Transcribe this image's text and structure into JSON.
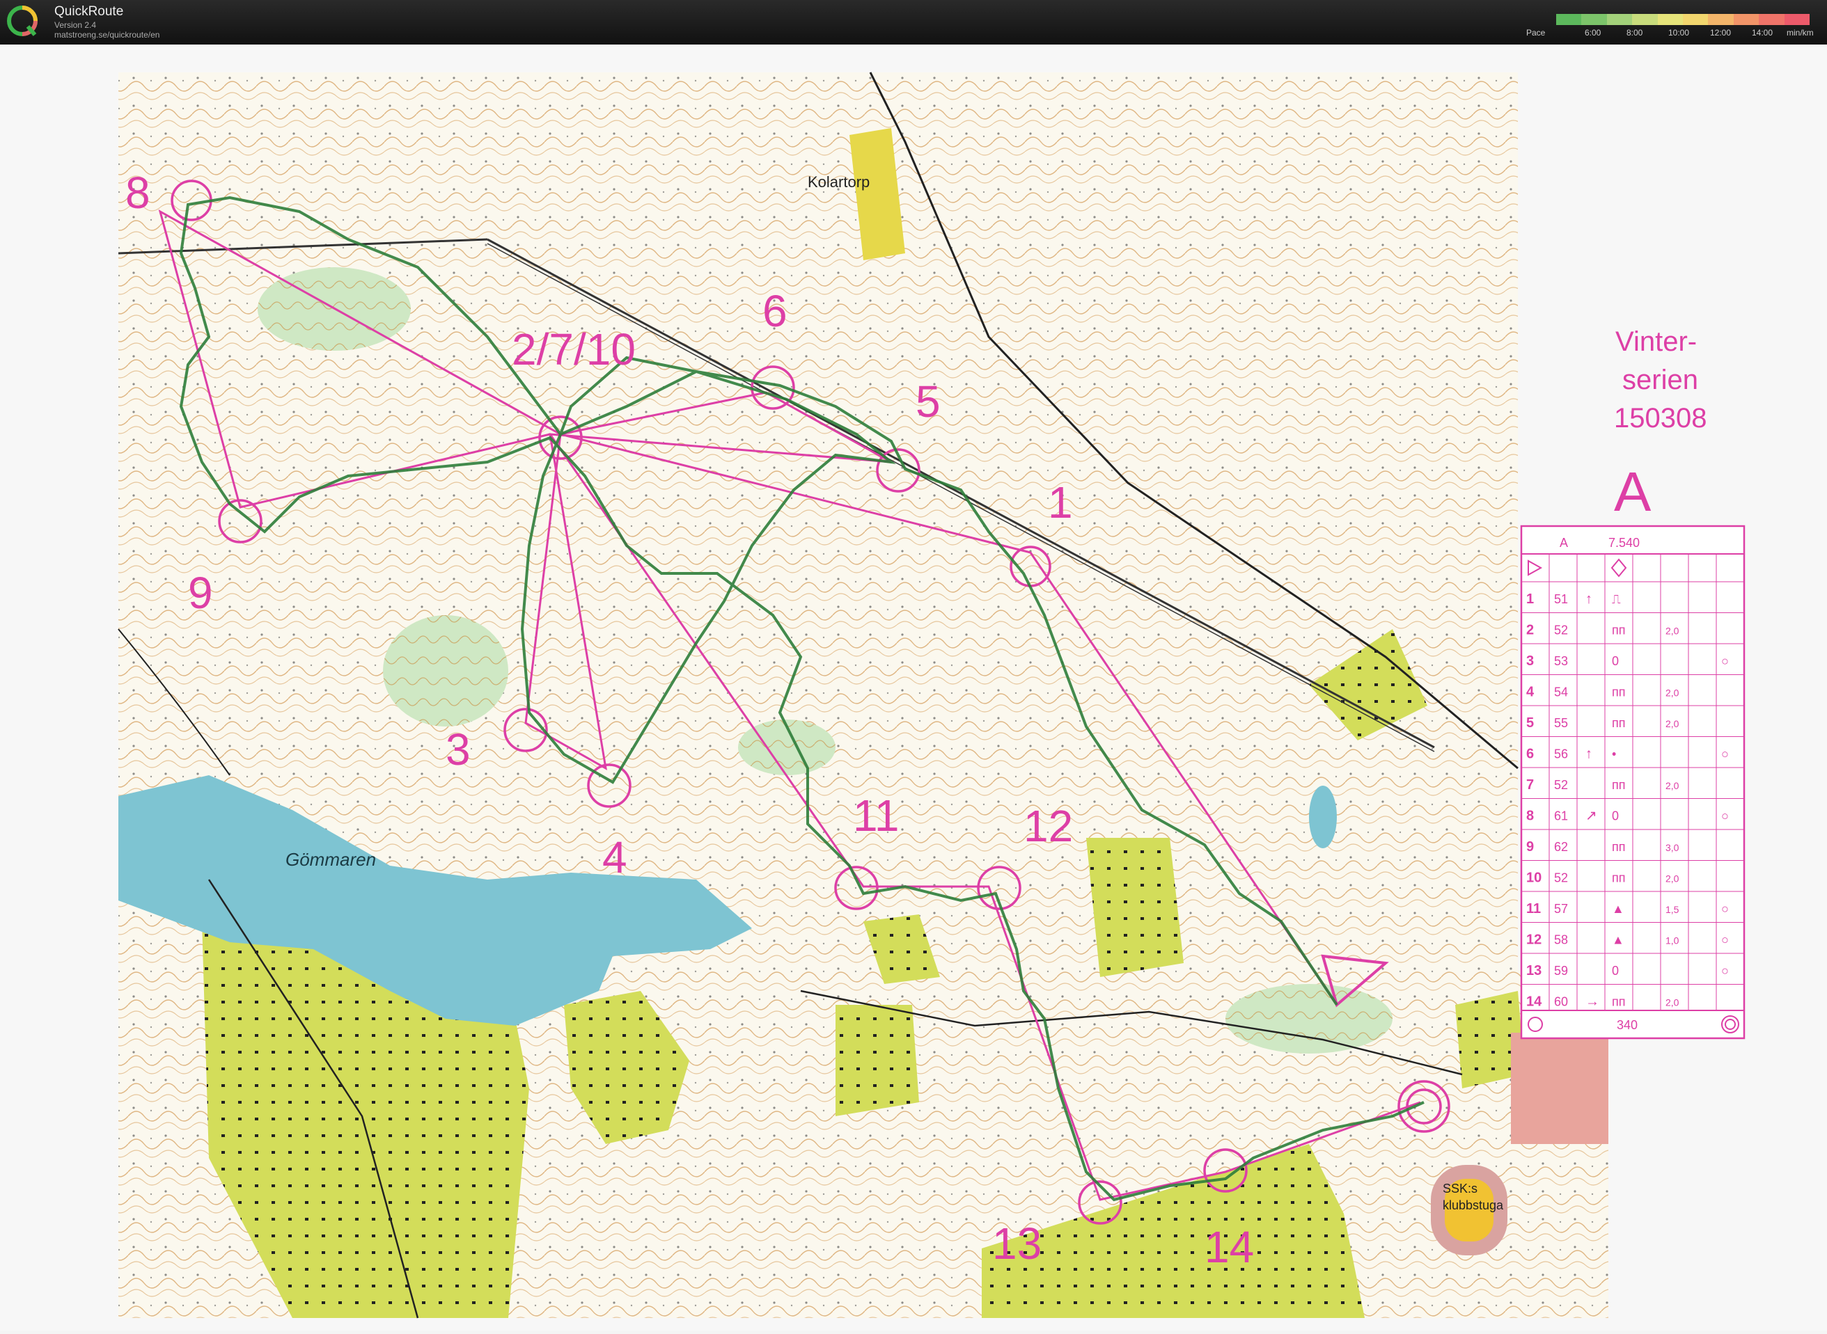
{
  "app": {
    "title": "QuickRoute",
    "version": "Version 2.4",
    "url": "matstroeng.se/quickroute/en"
  },
  "pace_legend": {
    "label": "Pace",
    "ticks": [
      "6:00",
      "8:00",
      "10:00",
      "12:00",
      "14:00"
    ],
    "unit": "min/km",
    "colors": [
      "#5cb85c",
      "#7cc46a",
      "#a3d17a",
      "#c8dc7c",
      "#e6e47a",
      "#f2d66e",
      "#f3b56a",
      "#f19468",
      "#ef7469",
      "#ec5a6a"
    ]
  },
  "map": {
    "event_title_line1": "Vinter-",
    "event_title_line2": "serien",
    "event_date": "150308",
    "course": "A",
    "place_labels": [
      "Kolartorp",
      "Gömmaren",
      "SSK:s",
      "klubbstuga"
    ],
    "control_numbers": [
      "2/7/10",
      "6",
      "5",
      "1",
      "8",
      "9",
      "3",
      "4",
      "11",
      "12",
      "13",
      "14"
    ],
    "colors": {
      "paper": "#fbf8ee",
      "forest_contour": "#c9893a",
      "water": "#7ec4d2",
      "field": "#c8d64a",
      "overprint": "#dd3fa6",
      "route": "#2e7d3a"
    }
  },
  "control_card": {
    "course": "A",
    "length": "7.540",
    "rows": [
      {
        "n": "1",
        "code": "51",
        "dir": "↑",
        "feature": "⎍",
        "size": "",
        "extra": ""
      },
      {
        "n": "2",
        "code": "52",
        "dir": "",
        "feature": "ᴨᴨ",
        "size": "2,0",
        "extra": ""
      },
      {
        "n": "3",
        "code": "53",
        "dir": "",
        "feature": "0",
        "size": "",
        "extra": "○"
      },
      {
        "n": "4",
        "code": "54",
        "dir": "",
        "feature": "ᴨᴨ",
        "size": "2,0",
        "extra": ""
      },
      {
        "n": "5",
        "code": "55",
        "dir": "",
        "feature": "ᴨᴨ",
        "size": "2,0",
        "extra": ""
      },
      {
        "n": "6",
        "code": "56",
        "dir": "↑",
        "feature": "•",
        "size": "",
        "extra": "○"
      },
      {
        "n": "7",
        "code": "52",
        "dir": "",
        "feature": "ᴨᴨ",
        "size": "2,0",
        "extra": ""
      },
      {
        "n": "8",
        "code": "61",
        "dir": "↗",
        "feature": "0",
        "size": "",
        "extra": "○"
      },
      {
        "n": "9",
        "code": "62",
        "dir": "",
        "feature": "ᴨᴨ",
        "size": "3,0",
        "extra": ""
      },
      {
        "n": "10",
        "code": "52",
        "dir": "",
        "feature": "ᴨᴨ",
        "size": "2,0",
        "extra": ""
      },
      {
        "n": "11",
        "code": "57",
        "dir": "",
        "feature": "▲",
        "size": "1,5",
        "extra": "○"
      },
      {
        "n": "12",
        "code": "58",
        "dir": "",
        "feature": "▲",
        "size": "1,0",
        "extra": "○"
      },
      {
        "n": "13",
        "code": "59",
        "dir": "",
        "feature": "0",
        "size": "",
        "extra": "○"
      },
      {
        "n": "14",
        "code": "60",
        "dir": "→",
        "feature": "ᴨᴨ",
        "size": "2,0",
        "extra": ""
      }
    ],
    "finish_distance": "340"
  }
}
